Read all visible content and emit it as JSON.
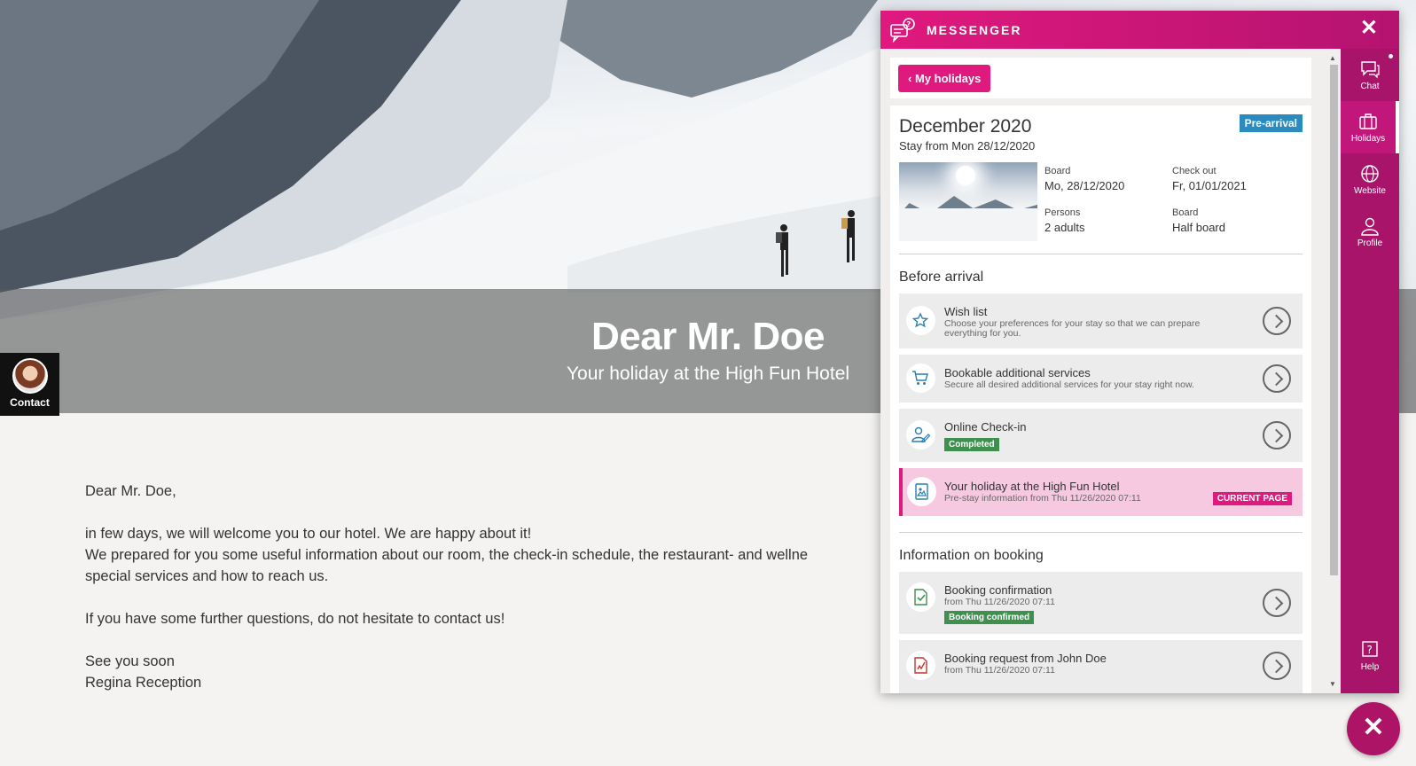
{
  "hero": {
    "title": "Dear Mr. Doe",
    "subtitle": "Your holiday at the High Fun Hotel"
  },
  "contact": {
    "label": "Contact"
  },
  "letter": {
    "greeting": "Dear Mr. Doe,",
    "line1": "in few days, we will welcome you to our hotel. We are happy about it!",
    "line2": "We prepared for you some useful information about our room, the check-in schedule, the restaurant- and wellne",
    "line3": "special services and how to reach us.",
    "line4": "If you have some further questions, do not hesitate to contact us!",
    "line5": "See you soon",
    "line6": "Regina Reception"
  },
  "messenger": {
    "title": "MESSENGER",
    "back_label": "My holidays",
    "holiday": {
      "title": "December 2020",
      "badge": "Pre-arrival",
      "stay": "Stay from Mon 28/12/2020",
      "board_label": "Board",
      "board_value": "Mo, 28/12/2020",
      "checkout_label": "Check out",
      "checkout_value": "Fr, 01/01/2021",
      "persons_label": "Persons",
      "persons_value": "2 adults",
      "board2_label": "Board",
      "board2_value": "Half board"
    },
    "before_arrival": "Before arrival",
    "items": [
      {
        "title": "Wish list",
        "desc": "Choose your preferences for your stay so that we can prepare everything for you."
      },
      {
        "title": "Bookable additional services",
        "desc": "Secure all desired additional services for your stay right now."
      },
      {
        "title": "Online Check-in",
        "tag": "Completed"
      },
      {
        "title": "Your holiday at the High Fun Hotel",
        "desc": "Pre-stay information from Thu 11/26/2020 07:11",
        "tag": "CURRENT PAGE"
      }
    ],
    "info_on_booking": "Information on booking",
    "booking_items": [
      {
        "title": "Booking confirmation",
        "desc": "from Thu 11/26/2020 07:11",
        "tag": "Booking confirmed"
      },
      {
        "title": "Booking request from John Doe",
        "desc": "from Thu 11/26/2020 07:11"
      }
    ],
    "nav": {
      "chat": "Chat",
      "holidays": "Holidays",
      "website": "Website",
      "profile": "Profile",
      "help": "Help"
    }
  },
  "colors": {
    "accent": "#e0197e",
    "nav": "#a81469",
    "badge_blue": "#2a8bbf",
    "green": "#3f8f4f"
  }
}
